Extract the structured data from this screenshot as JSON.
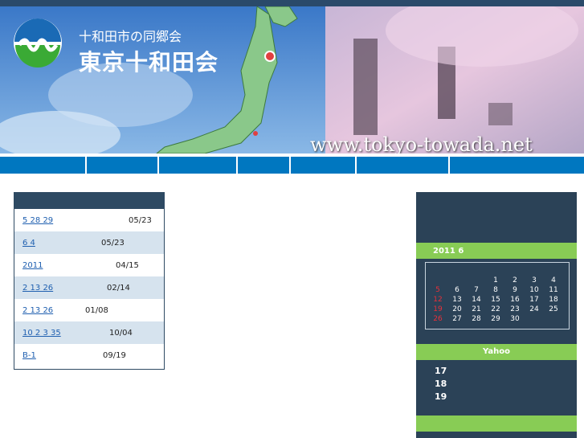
{
  "header": {
    "subtitle": "十和田市の同郷会",
    "title": "東京十和田会",
    "url": "www.tokyo-towada.net"
  },
  "nav": {
    "tabs": [
      "",
      "",
      "",
      "",
      "",
      "",
      "",
      ""
    ]
  },
  "news": {
    "items": [
      {
        "link": "5 28    29                    ",
        "date": "05/23"
      },
      {
        "link": "6 4                           ",
        "date": "05/23"
      },
      {
        "link": "2011                          ",
        "date": "04/15"
      },
      {
        "link": "2 13   26                    ",
        "date": "02/14"
      },
      {
        "link": "2 13   26          ",
        "date": "01/08"
      },
      {
        "link": "10 2  3  35                ",
        "date": "10/04"
      },
      {
        "link": "      B-1                  ",
        "date": "09/19"
      }
    ]
  },
  "calendar": {
    "label": "2011  6",
    "weeks": [
      [
        "",
        "",
        "",
        "1",
        "2",
        "3",
        "4"
      ],
      [
        "5",
        "6",
        "7",
        "8",
        "9",
        "10",
        "11"
      ],
      [
        "12",
        "13",
        "14",
        "15",
        "16",
        "17",
        "18"
      ],
      [
        "19",
        "20",
        "21",
        "22",
        "23",
        "24",
        "25"
      ],
      [
        "26",
        "27",
        "28",
        "29",
        "30",
        "",
        ""
      ]
    ]
  },
  "yahoo": {
    "label": "Yahoo",
    "items": [
      "17",
      "18",
      "19"
    ]
  },
  "colors": {
    "nav": "#0077c0",
    "panel": "#2b4257",
    "green": "#88cc55",
    "sunday": "#e8303a"
  }
}
